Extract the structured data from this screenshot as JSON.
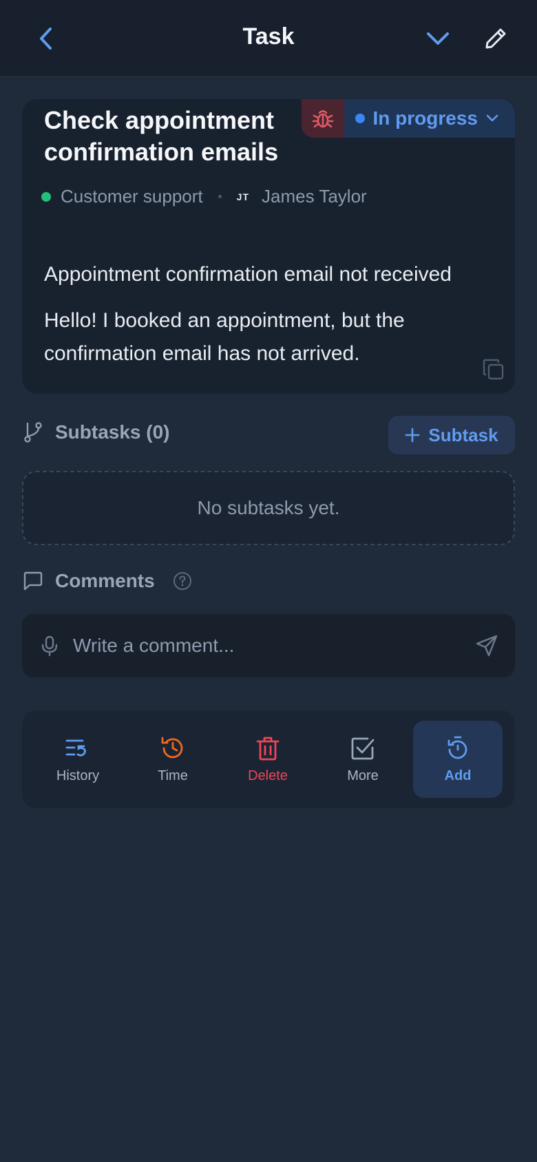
{
  "header": {
    "title": "Task"
  },
  "task": {
    "title": "Check appointment confirmation emails",
    "type_icon": "bug-icon",
    "status": "In progress",
    "team": "Customer support",
    "assignee_initials": "JT",
    "assignee": "James Taylor",
    "subject": "Appointment confirmation email not received",
    "body": "Hello! I booked an appointment, but the confirmation email has not arrived."
  },
  "subtasks": {
    "heading": "Subtasks (0)",
    "add_label": "Subtask",
    "empty": "No subtasks yet."
  },
  "comments": {
    "heading": "Comments",
    "placeholder": "Write a comment..."
  },
  "actions": [
    {
      "label": "History",
      "icon": "history-icon",
      "color": "#5f9cf0"
    },
    {
      "label": "Time",
      "icon": "clock-icon",
      "color": "#f06a1d"
    },
    {
      "label": "Delete",
      "icon": "trash-icon",
      "color": "#f04556"
    },
    {
      "label": "More",
      "icon": "checkbox-icon",
      "color": "#9aa6b8"
    },
    {
      "label": "Add",
      "icon": "timer-icon",
      "color": "#5f9cf0"
    }
  ],
  "colors": {
    "accent": "#5f9cf0",
    "background": "#1f2a3b",
    "card": "#18212e",
    "status_dot": "#3d86f2",
    "team_dot": "#22c07a"
  }
}
